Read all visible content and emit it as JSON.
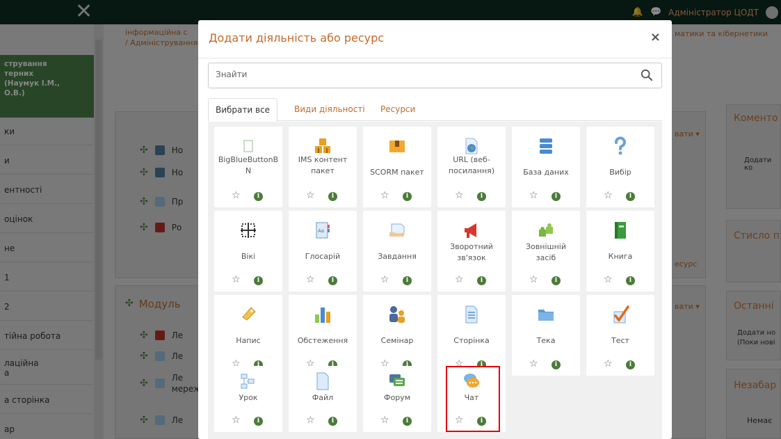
{
  "topbar": {
    "close_glyph": "✕",
    "admin_name": "Адміністратор ЦОДТ"
  },
  "background": {
    "breadcrumb_line1": "інформаційна с",
    "breadcrumb_line2": "/  Адміністрування",
    "breadcrumb_right": "матики та кібернетики",
    "sidebar_course": "стрування\nтерних\n(Наумук І.М.,\nО.В.)",
    "sidebar_items": [
      "ки",
      "и",
      "ентності",
      "оцінок",
      "не",
      "1",
      "2",
      "тійна робота",
      "лаційна\nа",
      "а сторінка",
      "ар"
    ],
    "section_rows": [
      "Но",
      "Но",
      "Пр",
      "Ро"
    ],
    "module_title": "Модуль",
    "module_rows": [
      "Ле",
      "Ле",
      "Ле\nмереж",
      "Ле"
    ],
    "edit_label_1": "вати ▾",
    "edit_label_2": "вати ▾",
    "resource_label": "есурс",
    "right_blocks": [
      {
        "title": "Коменто",
        "text": "Додати ко"
      },
      {
        "title": "Стисло п",
        "text": ""
      },
      {
        "title": "Останні",
        "text": "Додати но\n(Поки нові"
      },
      {
        "title": "Незабар",
        "text": "Немає"
      }
    ]
  },
  "modal": {
    "title": "Додати діяльність або ресурс",
    "close_glyph": "×",
    "search_placeholder": "Знайти",
    "tabs": [
      "Вибрати все",
      "Види діяльності",
      "Ресурси"
    ],
    "tiles": [
      {
        "label": "BigBlueButtonB\nN",
        "icon": "bigbluebutton-icon"
      },
      {
        "label": "IMS контент\nпакет",
        "icon": "ims-package-icon"
      },
      {
        "label": "SCORM пакет",
        "icon": "scorm-package-icon"
      },
      {
        "label": "URL (веб-\nпосилання)",
        "icon": "url-globe-icon"
      },
      {
        "label": "База даних",
        "icon": "database-icon"
      },
      {
        "label": "Вибір",
        "icon": "choice-question-icon"
      },
      {
        "label": "Вікі",
        "icon": "wiki-icon"
      },
      {
        "label": "Глосарій",
        "icon": "glossary-icon"
      },
      {
        "label": "Завдання",
        "icon": "assignment-icon"
      },
      {
        "label": "Зворотний\nзв'язок",
        "icon": "feedback-megaphone-icon"
      },
      {
        "label": "Зовнішній\nзасіб",
        "icon": "external-tool-puzzle-icon"
      },
      {
        "label": "Книга",
        "icon": "book-icon"
      },
      {
        "label": "Напис",
        "icon": "label-tag-icon"
      },
      {
        "label": "Обстеження",
        "icon": "survey-chart-icon"
      },
      {
        "label": "Семінар",
        "icon": "workshop-people-icon"
      },
      {
        "label": "Сторінка",
        "icon": "page-icon"
      },
      {
        "label": "Тека",
        "icon": "folder-icon"
      },
      {
        "label": "Тест",
        "icon": "quiz-checkmark-icon"
      },
      {
        "label": "Урок",
        "icon": "lesson-icon"
      },
      {
        "label": "Файл",
        "icon": "file-icon"
      },
      {
        "label": "Форум",
        "icon": "forum-icon"
      },
      {
        "label": "Чат",
        "icon": "chat-icon"
      }
    ],
    "fav_glyph": "☆",
    "info_glyph": "i",
    "highlighted_tile": "Чат"
  },
  "colors": {
    "accent_orange": "#c46a2c",
    "green": "#4d7b3a",
    "highlight_red": "#e20000"
  }
}
